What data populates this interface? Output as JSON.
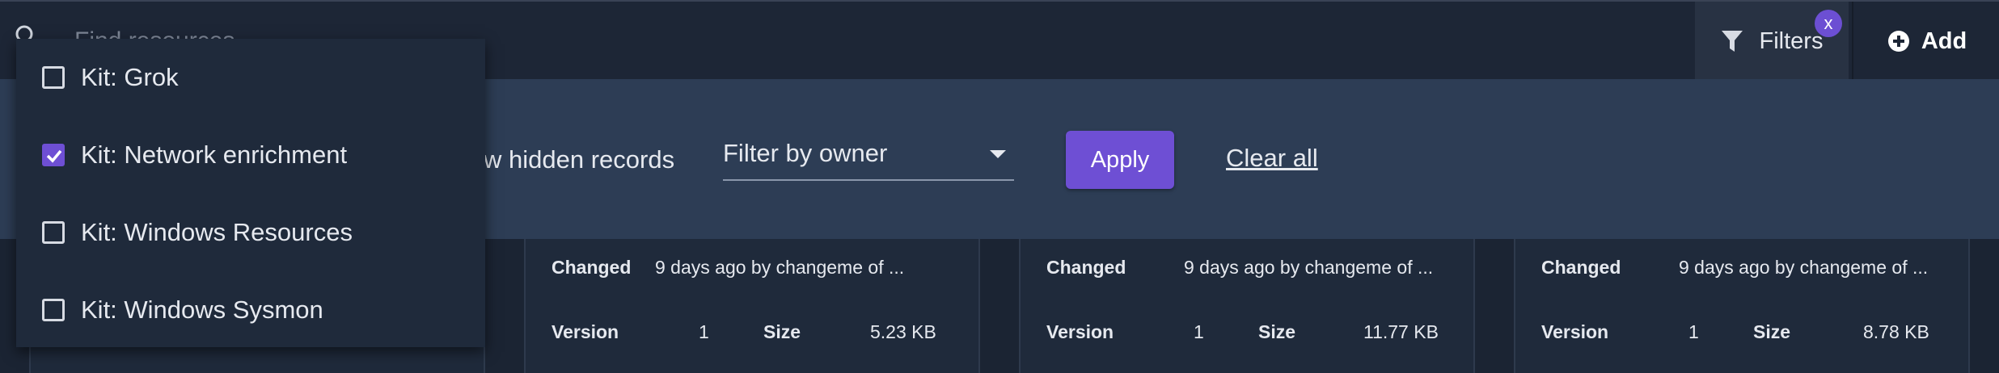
{
  "search": {
    "placeholder": "Find resources"
  },
  "toolbar": {
    "filters_label": "Filters",
    "filters_badge": "x",
    "add_label": "Add"
  },
  "filter_bar": {
    "show_hidden_label": "w hidden records",
    "owner_select_value": "Filter by owner",
    "apply_label": "Apply",
    "clear_label": "Clear all"
  },
  "kit_options": [
    {
      "label": "Kit: Grok",
      "checked": false
    },
    {
      "label": "Kit: Network enrichment",
      "checked": true
    },
    {
      "label": "Kit: Windows Resources",
      "checked": false
    },
    {
      "label": "Kit: Windows Sysmon",
      "checked": false
    }
  ],
  "cards": [
    {
      "changed_label": "Changed",
      "changed_value": "9 days ago by changeme of ...",
      "version_label": "Version",
      "version_value": "1",
      "size_label": "Size",
      "size_value": "5.23 KB"
    },
    {
      "changed_label": "Changed",
      "changed_value": "9 days ago by changeme of ...",
      "version_label": "Version",
      "version_value": "1",
      "size_label": "Size",
      "size_value": "11.77 KB"
    },
    {
      "changed_label": "Changed",
      "changed_value": "9 days ago by changeme of ...",
      "version_label": "Version",
      "version_value": "1",
      "size_label": "Size",
      "size_value": "8.78 KB"
    }
  ],
  "colors": {
    "accent": "#6e4fd4",
    "topbar": "#1d2636",
    "filter_bar": "#2d3d55",
    "card": "#1f2a3b"
  }
}
